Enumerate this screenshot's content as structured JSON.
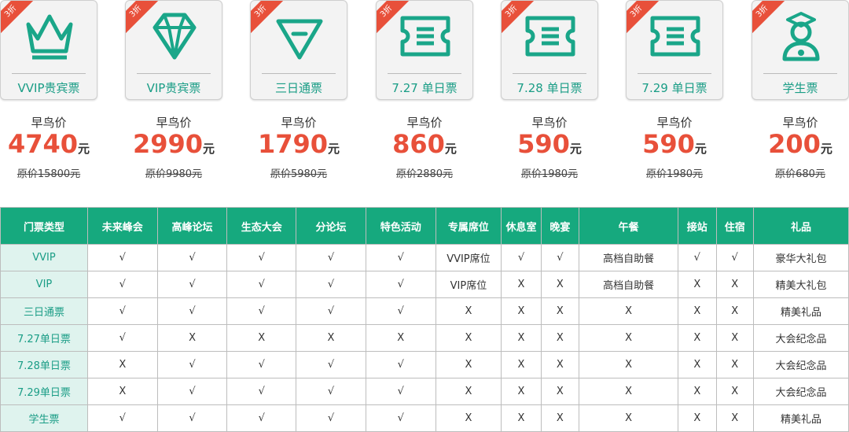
{
  "tickets": [
    {
      "badge": "3折",
      "name": "VVIP贵宾票",
      "icon": "crown-icon",
      "label": "早鸟价",
      "price": "4740",
      "unit": "元",
      "original": "原价15800元"
    },
    {
      "badge": "3折",
      "name": "VIP贵宾票",
      "icon": "diamond-icon",
      "label": "早鸟价",
      "price": "2990",
      "unit": "元",
      "original": "原价9980元"
    },
    {
      "badge": "3折",
      "name": "三日通票",
      "icon": "gem-icon",
      "label": "早鸟价",
      "price": "1790",
      "unit": "元",
      "original": "原价5980元"
    },
    {
      "badge": "3折",
      "name": "7.27 单日票",
      "icon": "ticket-icon",
      "label": "早鸟价",
      "price": "860",
      "unit": "元",
      "original": "原价2880元"
    },
    {
      "badge": "3折",
      "name": "7.28 单日票",
      "icon": "ticket-icon",
      "label": "早鸟价",
      "price": "590",
      "unit": "元",
      "original": "原价1980元"
    },
    {
      "badge": "3折",
      "name": "7.29 单日票",
      "icon": "ticket-icon",
      "label": "早鸟价",
      "price": "590",
      "unit": "元",
      "original": "原价1980元"
    },
    {
      "badge": "3折",
      "name": "学生票",
      "icon": "student-icon",
      "label": "早鸟价",
      "price": "200",
      "unit": "元",
      "original": "原价680元"
    }
  ],
  "table": {
    "headers": [
      "门票类型",
      "未来峰会",
      "高峰论坛",
      "生态大会",
      "分论坛",
      "特色活动",
      "专属席位",
      "休息室",
      "晚宴",
      "午餐",
      "接站",
      "住宿",
      "礼品"
    ],
    "rows": [
      [
        "VVIP",
        "√",
        "√",
        "√",
        "√",
        "√",
        "VVIP席位",
        "√",
        "√",
        "高档自助餐",
        "√",
        "√",
        "豪华大礼包"
      ],
      [
        "VIP",
        "√",
        "√",
        "√",
        "√",
        "√",
        "VIP席位",
        "X",
        "X",
        "高档自助餐",
        "X",
        "X",
        "精美大礼包"
      ],
      [
        "三日通票",
        "√",
        "√",
        "√",
        "√",
        "√",
        "X",
        "X",
        "X",
        "X",
        "X",
        "X",
        "精美礼品"
      ],
      [
        "7.27单日票",
        "√",
        "X",
        "X",
        "X",
        "X",
        "X",
        "X",
        "X",
        "X",
        "X",
        "X",
        "大会纪念品"
      ],
      [
        "7.28单日票",
        "X",
        "√",
        "√",
        "√",
        "√",
        "X",
        "X",
        "X",
        "X",
        "X",
        "X",
        "大会纪念品"
      ],
      [
        "7.29单日票",
        "X",
        "√",
        "√",
        "√",
        "√",
        "X",
        "X",
        "X",
        "X",
        "X",
        "X",
        "大会纪念品"
      ],
      [
        "学生票",
        "√",
        "√",
        "√",
        "√",
        "√",
        "X",
        "X",
        "X",
        "X",
        "X",
        "X",
        "精美礼品"
      ]
    ]
  },
  "colors": {
    "accent": "#1a9d86",
    "header_bg": "#16a97e",
    "price": "#e8503a",
    "row_header_bg": "#dff3ee"
  }
}
